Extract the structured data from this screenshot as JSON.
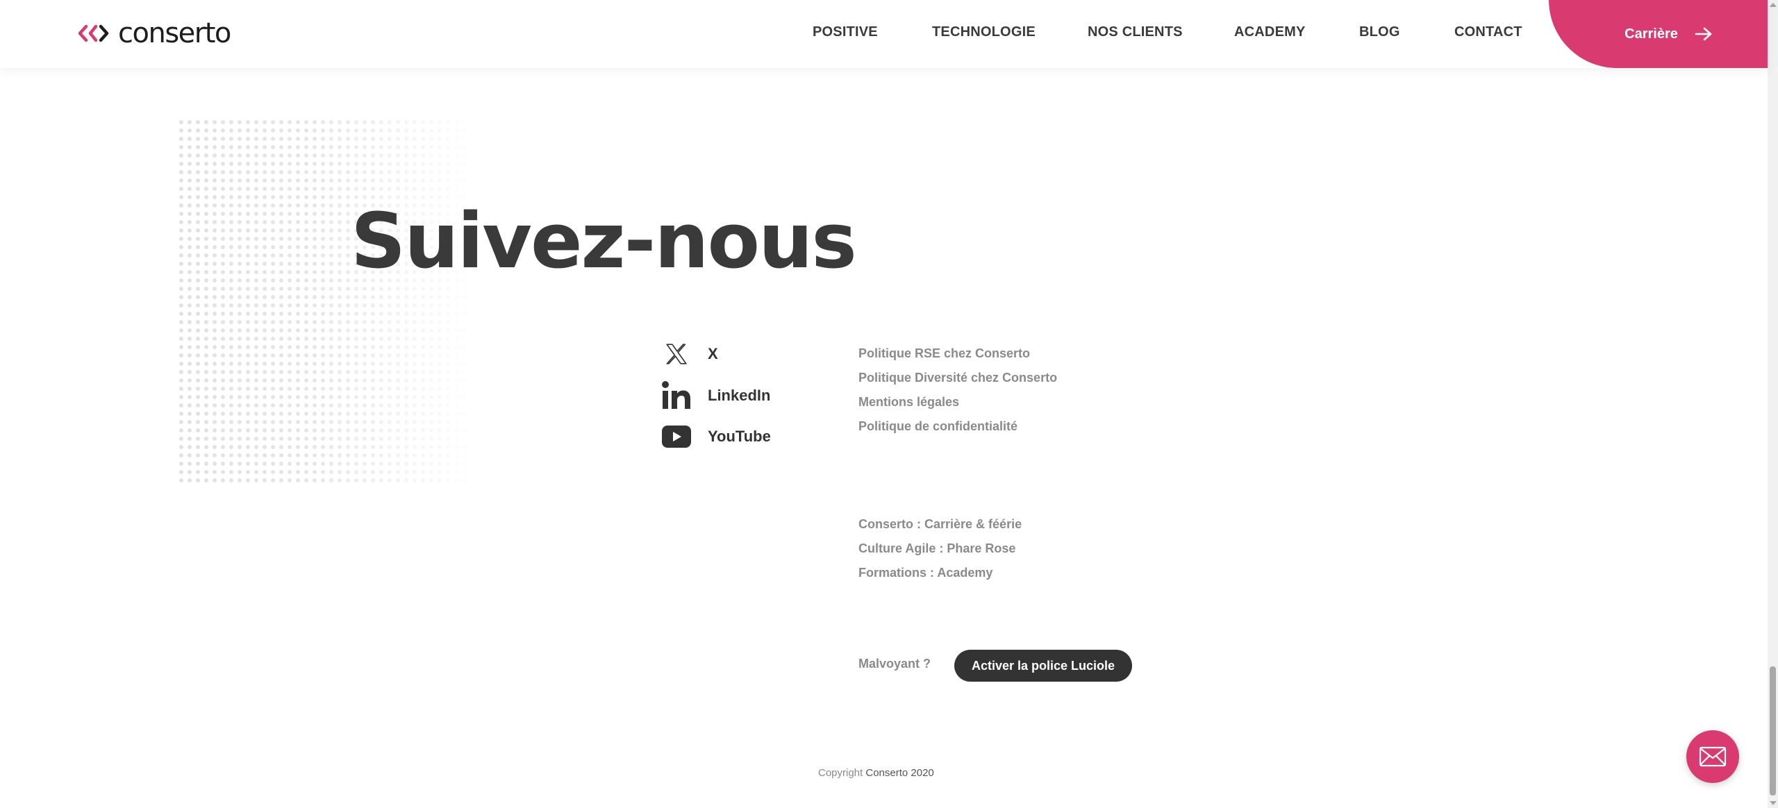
{
  "header": {
    "logo_text": "conserto",
    "nav": [
      {
        "label": "POSITIVE"
      },
      {
        "label": "TECHNOLOGIE"
      },
      {
        "label": "NOS CLIENTS"
      },
      {
        "label": "ACADEMY"
      },
      {
        "label": "BLOG"
      },
      {
        "label": "CONTACT"
      }
    ],
    "career_label": "Carrière"
  },
  "main": {
    "title": "Suivez-nous",
    "social": [
      {
        "label": "X",
        "icon": "x-icon"
      },
      {
        "label": "LinkedIn",
        "icon": "linkedin-icon"
      },
      {
        "label": "YouTube",
        "icon": "youtube-icon"
      }
    ],
    "legal_links": [
      {
        "label": "Politique RSE chez Conserto"
      },
      {
        "label": "Politique Diversité chez Conserto"
      },
      {
        "label": "Mentions légales"
      },
      {
        "label": "Politique de confidentialité"
      }
    ],
    "site_links": [
      {
        "label": "Conserto : Carrière & féérie"
      },
      {
        "label": "Culture Agile : Phare Rose"
      },
      {
        "label": "Formations : Academy"
      }
    ],
    "accessibility": {
      "question": "Malvoyant ?",
      "button_label": "Activer la police Luciole"
    }
  },
  "footer": {
    "copyright_prefix": "Copyright",
    "copyright_brand": "Conserto 2020"
  },
  "colors": {
    "accent": "#d93a70",
    "text_dark": "#3a3a3a",
    "text_muted": "#8a8a8a",
    "button_dark": "#333333"
  },
  "icons": {
    "chat": "mail-icon",
    "career_arrow": "arrow-right-icon"
  }
}
